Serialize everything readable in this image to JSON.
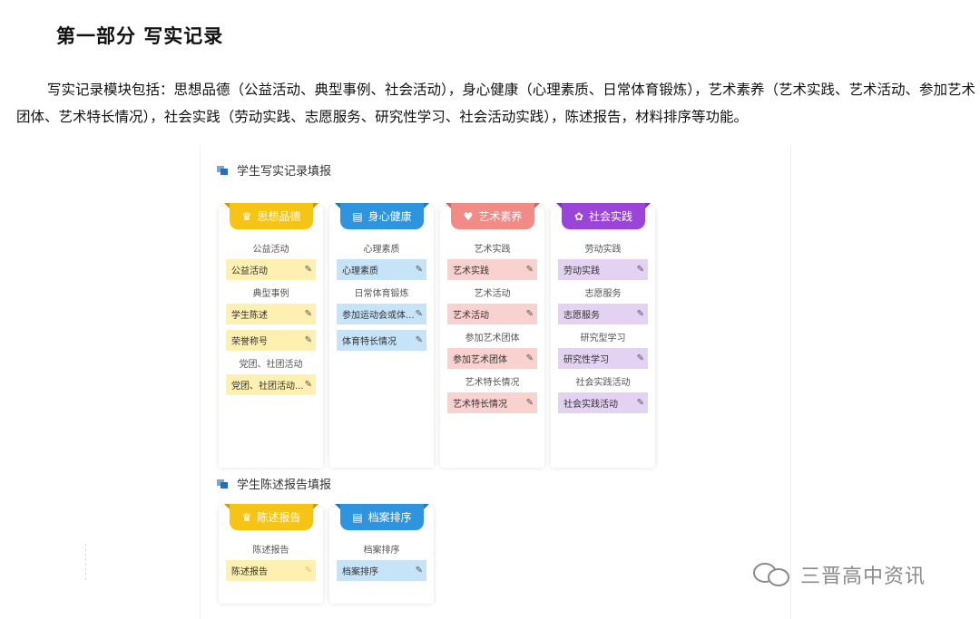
{
  "section_title": "第一部分  写实记录",
  "intro": "写实记录模块包括：思想品德（公益活动、典型事例、社会活动），身心健康（心理素质、日常体育锻炼），艺术素养（艺术实践、艺术活动、参加艺术团体、艺术特长情况），社会实践（劳动实践、志愿服务、研究性学习、社会活动实践），陈述报告，材料排序等功能。",
  "record_panel": {
    "header": "学生写实记录填报",
    "cards": [
      {
        "title": "思想品德",
        "icon": "crown-icon",
        "groups": [
          {
            "label": "公益活动",
            "items": [
              "公益活动"
            ]
          },
          {
            "label": "典型事例",
            "items": [
              "学生陈述",
              "荣誉称号"
            ]
          },
          {
            "label": "党团、社团活动",
            "items": [
              "党团、社团活动..."
            ]
          }
        ]
      },
      {
        "title": "身心健康",
        "icon": "document-icon",
        "groups": [
          {
            "label": "心理素质",
            "items": [
              "心理素质"
            ]
          },
          {
            "label": "日常体育锻炼",
            "items": [
              "参加运动会或体...",
              "体育特长情况"
            ]
          }
        ]
      },
      {
        "title": "艺术素养",
        "icon": "heart-icon",
        "groups": [
          {
            "label": "艺术实践",
            "items": [
              "艺术实践"
            ]
          },
          {
            "label": "艺术活动",
            "items": [
              "艺术活动"
            ]
          },
          {
            "label": "参加艺术团体",
            "items": [
              "参加艺术团体"
            ]
          },
          {
            "label": "艺术特长情况",
            "items": [
              "艺术特长情况"
            ]
          }
        ]
      },
      {
        "title": "社会实践",
        "icon": "palette-icon",
        "groups": [
          {
            "label": "劳动实践",
            "items": [
              "劳动实践"
            ]
          },
          {
            "label": "志愿服务",
            "items": [
              "志愿服务"
            ]
          },
          {
            "label": "研究型学习",
            "items": [
              "研究性学习"
            ]
          },
          {
            "label": "社会实践活动",
            "items": [
              "社会实践活动"
            ]
          }
        ]
      }
    ]
  },
  "report_panel": {
    "header": "学生陈述报告填报",
    "cards": [
      {
        "title": "陈述报告",
        "icon": "crown-icon",
        "groups": [
          {
            "label": "陈述报告",
            "items": [
              "陈述报告"
            ]
          }
        ]
      },
      {
        "title": "档案排序",
        "icon": "document-icon",
        "groups": [
          {
            "label": "档案排序",
            "items": [
              "档案排序"
            ]
          }
        ]
      }
    ]
  },
  "watermark": "三晋高中资讯"
}
